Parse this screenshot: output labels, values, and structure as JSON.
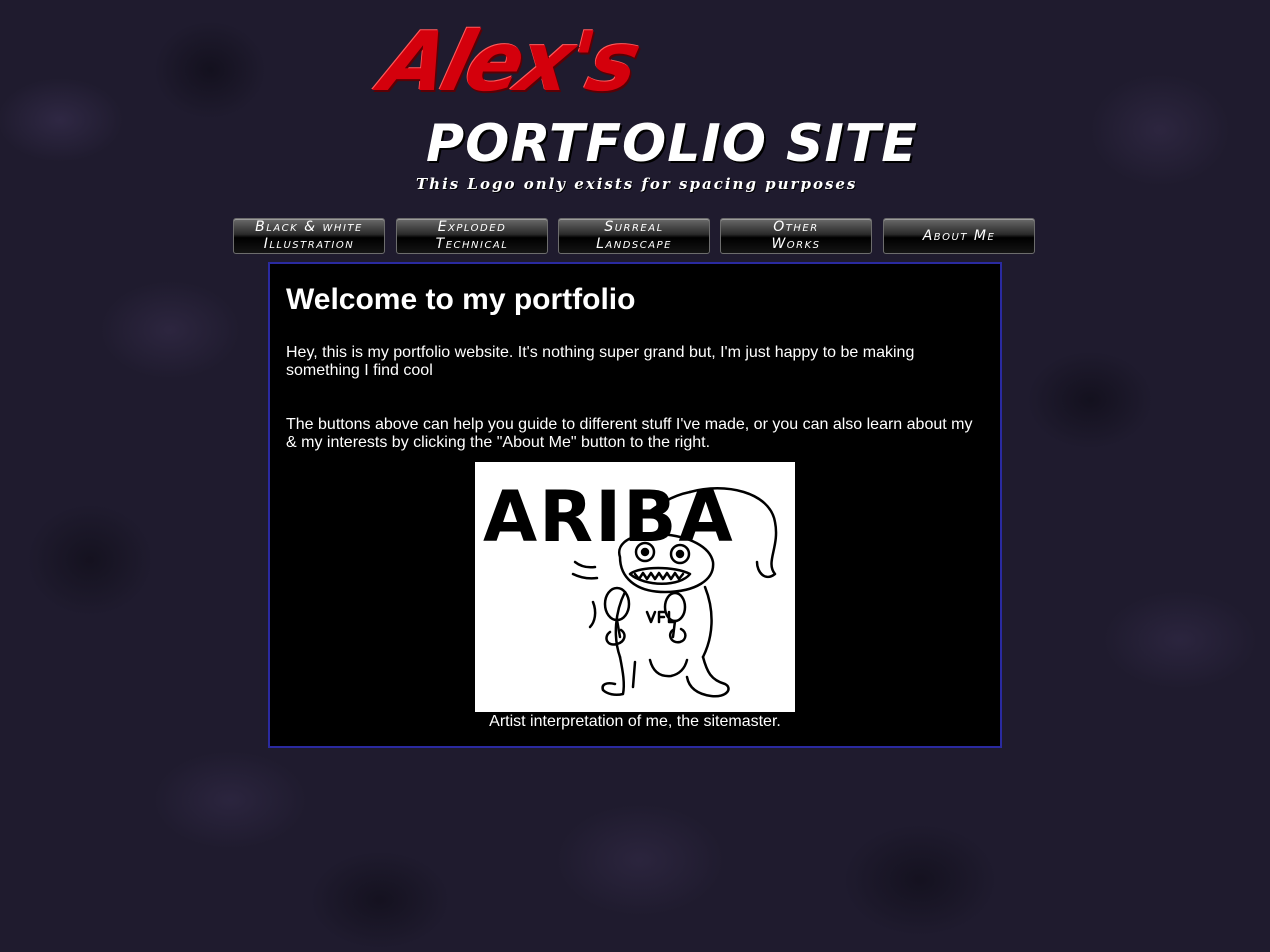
{
  "logo": {
    "line1": "Alex's",
    "line2": "PORTFOLIO SITE",
    "tagline": "This Logo only exists for spacing purposes"
  },
  "nav": {
    "items": [
      {
        "label": "Black & white\nIllustration"
      },
      {
        "label": "Exploded\nTechnical"
      },
      {
        "label": "Surreal\nLandscape"
      },
      {
        "label": "Other\nWorks"
      },
      {
        "label": "About Me"
      }
    ]
  },
  "main": {
    "heading": "Welcome to my portfolio",
    "paragraph1": "Hey, this is my portfolio website. It's nothing super grand but, I'm just happy to be making something I find cool",
    "paragraph2": "The buttons above can help you guide to different stuff I've made, or you can also learn about my & my interests by clicking the \"About Me\" button to the right.",
    "image_text": "ARIBA",
    "caption": "Artist interpretation of me, the sitemaster."
  },
  "colors": {
    "background": "#1f1b2e",
    "logo_red": "#d4000c",
    "content_border": "#2a2aa0",
    "content_background": "#000000"
  }
}
